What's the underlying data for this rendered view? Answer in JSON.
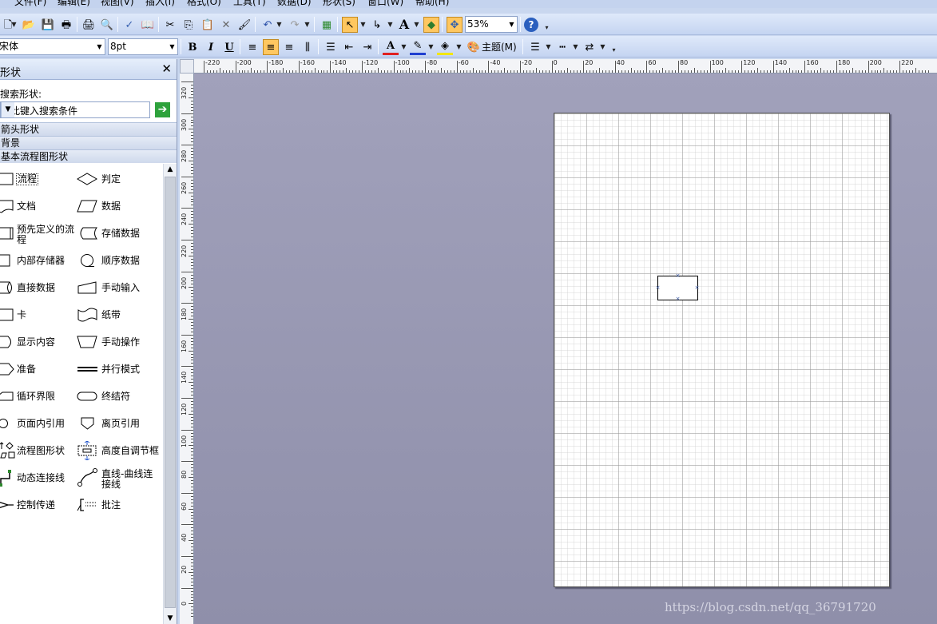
{
  "menu": [
    "文件(F)",
    "编辑(E)",
    "视图(V)",
    "插入(I)",
    "格式(O)",
    "工具(T)",
    "数据(D)",
    "形状(S)",
    "窗口(W)",
    "帮助(H)"
  ],
  "toolbar": {
    "zoom": "53%",
    "font_name": "宋体",
    "font_size": "8pt",
    "bold": "B",
    "italic": "I",
    "underline": "U",
    "theme_label": "主题(M)",
    "text_tool": "A"
  },
  "shapes_panel": {
    "title": "形状",
    "search_label": "搜索形状:",
    "search_placeholder": "在此键入搜索条件",
    "categories": [
      "箭头形状",
      "背景",
      "基本流程图形状"
    ],
    "items": [
      "流程",
      "判定",
      "文档",
      "数据",
      "预先定义的流程",
      "存储数据",
      "内部存储器",
      "顺序数据",
      "直接数据",
      "手动输入",
      "卡",
      "纸带",
      "显示内容",
      "手动操作",
      "准备",
      "并行模式",
      "循环界限",
      "终结符",
      "页面内引用",
      "离页引用",
      "流程图形状",
      "高度自调节框",
      "动态连接线",
      "直线-曲线连接线",
      "控制传递",
      "批注"
    ]
  },
  "rulers": {
    "horizontal": [
      "-220",
      "-200",
      "-180",
      "-160",
      "-140",
      "-120",
      "-100",
      "-80",
      "-60",
      "-40",
      "-20",
      "0",
      "20",
      "40",
      "60",
      "80",
      "100",
      "120",
      "140",
      "160",
      "180",
      "200",
      "220"
    ],
    "vertical": [
      "320",
      "300",
      "280",
      "260",
      "240",
      "220",
      "200",
      "180",
      "160",
      "140",
      "120",
      "100",
      "80",
      "60",
      "40",
      "20",
      "0"
    ]
  },
  "watermark": "https://blog.csdn.net/qq_36791720"
}
